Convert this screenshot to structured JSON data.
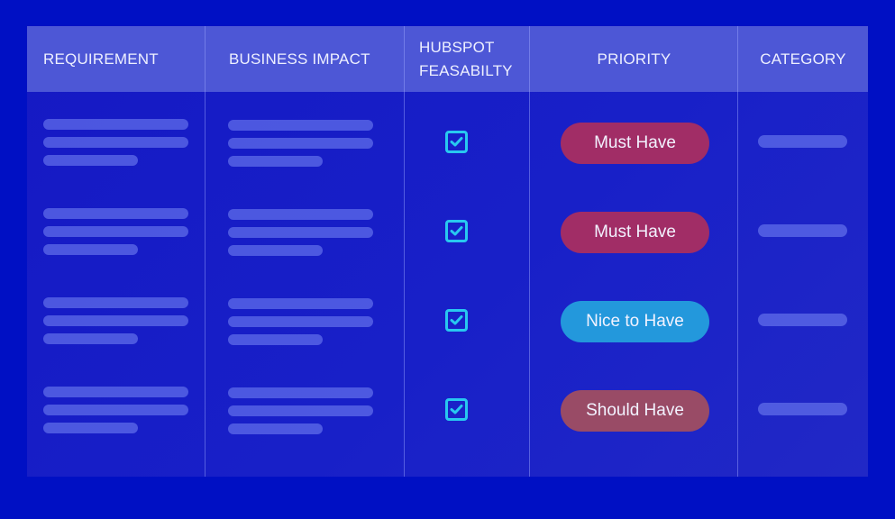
{
  "table": {
    "columns": [
      {
        "key": "requirement",
        "label": "REQUIREMENT"
      },
      {
        "key": "business_impact",
        "label": "BUSINESS IMPACT"
      },
      {
        "key": "hubspot_feasibility",
        "label_line1": "HUBSPOT",
        "label_line2": "FEASABILTY"
      },
      {
        "key": "priority",
        "label": "PRIORITY"
      },
      {
        "key": "category",
        "label": "CATEGORY"
      }
    ],
    "rows": [
      {
        "requirement": "placeholder-text",
        "business_impact": "placeholder-text",
        "hubspot_feasible": true,
        "priority": "Must Have",
        "priority_color": "#a12d66",
        "category": "placeholder-text"
      },
      {
        "requirement": "placeholder-text",
        "business_impact": "placeholder-text",
        "hubspot_feasible": true,
        "priority": "Must Have",
        "priority_color": "#a12d66",
        "category": "placeholder-text"
      },
      {
        "requirement": "placeholder-text",
        "business_impact": "placeholder-text",
        "hubspot_feasible": true,
        "priority": "Nice to Have",
        "priority_color": "#2398dc",
        "category": "placeholder-text"
      },
      {
        "requirement": "placeholder-text",
        "business_impact": "placeholder-text",
        "hubspot_feasible": true,
        "priority": "Should Have",
        "priority_color": "#994b66",
        "category": "placeholder-text"
      }
    ]
  },
  "icons": {
    "checkbox": "checkbox-checked-icon"
  },
  "colors": {
    "background": "#0010c4",
    "header": "#4d57d6",
    "checkbox": "#28c8f0",
    "must_have": "#a12d66",
    "nice_to_have": "#2398dc",
    "should_have": "#994b66"
  }
}
